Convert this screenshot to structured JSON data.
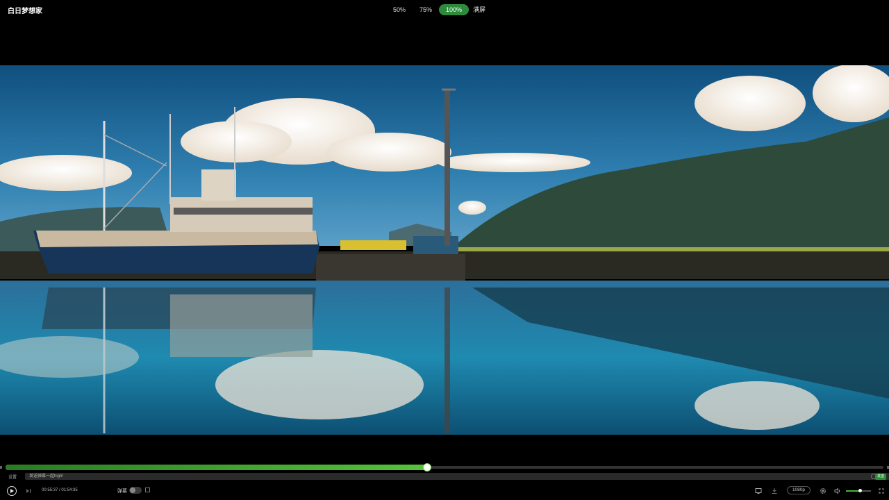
{
  "header": {
    "title": "白日梦想家",
    "zoom_options": [
      "50%",
      "75%",
      "100%",
      "满屏"
    ],
    "zoom_selected": "100%"
  },
  "video": {
    "progress_fraction": 0.48,
    "volume_fraction": 0.55
  },
  "danmu_bar": {
    "settings_label": "设置",
    "placeholder": "发送弹幕一起high!",
    "send_label": "发送"
  },
  "controls": {
    "time_current": "00:55:37",
    "time_total": "01:54:35",
    "time_separator": " / ",
    "danmu_label": "弹幕",
    "quality": "1080p"
  },
  "icons": {
    "play": "play-icon",
    "next": "next-icon",
    "danmu_settings": "danmu-settings-icon",
    "screenshot": "screenshot-icon",
    "download": "download-icon",
    "settings": "gear-icon",
    "volume": "volume-icon",
    "fullscreen": "fullscreen-icon"
  },
  "colors": {
    "accent": "#2f8b3c",
    "progress_start": "#2a7a23",
    "progress_end": "#56c43a",
    "background": "#000000"
  }
}
